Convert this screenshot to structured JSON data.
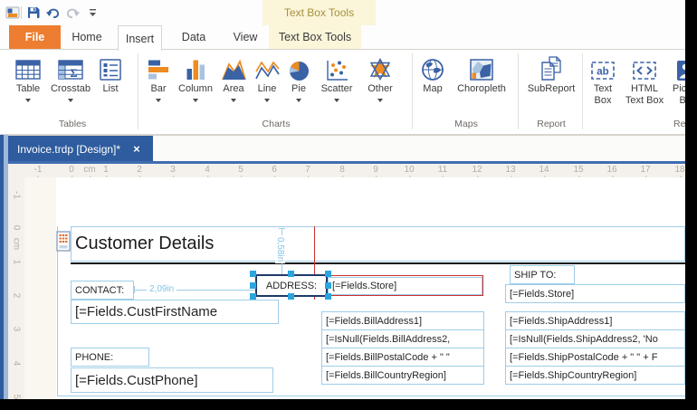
{
  "titlebar": {
    "contextual_title": "Text Box Tools",
    "qat_icons": [
      "app-icon",
      "save-icon",
      "undo-icon",
      "redo-icon",
      "customize-qat-icon"
    ]
  },
  "tabs": {
    "file": "File",
    "home": "Home",
    "insert": "Insert",
    "data": "Data",
    "view": "View",
    "contextual": "Text Box Tools"
  },
  "ribbon": {
    "groups": [
      {
        "label": "Tables",
        "buttons": [
          {
            "label": "Table",
            "dropdown": true
          },
          {
            "label": "Crosstab",
            "dropdown": true
          },
          {
            "label": "List",
            "dropdown": false
          }
        ]
      },
      {
        "label": "Charts",
        "buttons": [
          {
            "label": "Bar",
            "dropdown": true
          },
          {
            "label": "Column",
            "dropdown": true
          },
          {
            "label": "Area",
            "dropdown": true
          },
          {
            "label": "Line",
            "dropdown": true
          },
          {
            "label": "Pie",
            "dropdown": true
          },
          {
            "label": "Scatter",
            "dropdown": true
          },
          {
            "label": "Other",
            "dropdown": true
          }
        ]
      },
      {
        "label": "Maps",
        "buttons": [
          {
            "label": "Map",
            "dropdown": false
          },
          {
            "label": "Choropleth",
            "dropdown": false
          }
        ]
      },
      {
        "label": "Report",
        "buttons": [
          {
            "label": "SubReport",
            "dropdown": false
          }
        ]
      },
      {
        "label": "Report Items",
        "buttons": [
          {
            "label": "Text Box",
            "dropdown": false
          },
          {
            "label": "HTML Text Box",
            "dropdown": false
          },
          {
            "label": "Picture Box",
            "dropdown": false
          }
        ]
      }
    ]
  },
  "document_tab": {
    "title": "Invoice.trdp [Design]*",
    "close_glyph": "×"
  },
  "ruler": {
    "unit": "cm",
    "horizontal": [
      "-1",
      "0",
      "cm",
      "1",
      "2",
      "3",
      "4",
      "5",
      "6",
      "7",
      "8",
      "9",
      "10",
      "11",
      "12",
      "13",
      "14",
      "15",
      "16",
      "17",
      "18"
    ],
    "vertical": [
      "-1",
      "0",
      "cm",
      "1",
      "2",
      "3",
      "4",
      "5"
    ]
  },
  "design": {
    "section_title": "Customer Details",
    "dim_vertical": "0,58in",
    "dim_horizontal": "2,09in",
    "contact_label": "CONTACT:",
    "contact_value": "[=Fields.CustFirstName",
    "phone_label": "PHONE:",
    "phone_value": "[=Fields.CustPhone]",
    "address_label": "ADDRESS:",
    "bill": {
      "store": "[=Fields.Store]",
      "lines": [
        "[=Fields.BillAddress1]",
        "[=IsNull(Fields.BillAddress2,",
        "[=Fields.BillPostalCode + \" \"",
        "[=Fields.BillCountryRegion]"
      ]
    },
    "ship": {
      "label": "SHIP TO:",
      "store": "[=Fields.Store]",
      "lines": [
        "[=Fields.ShipAddress1]",
        "[=IsNull(Fields.ShipAddress2, 'No",
        "[=Fields.ShipPostalCode + \" \" + F",
        "[=Fields.ShipCountryRegion]"
      ]
    }
  },
  "colors": {
    "file_tab_orange": "#ED7D31",
    "contextual_yellow": "#FBF5DA",
    "contextual_text_gold": "#A6913C",
    "doc_tab_blue": "#2E5C9E",
    "adorner_light_blue": "#9ECDE8",
    "selection_handle_blue": "#2AA5DE",
    "selection_border_navy": "#1E3A68",
    "snapline_red": "#CE2F2F",
    "icon_blue": "#3A62A5",
    "icon_orange": "#EE8B21",
    "icon_light_blue": "#A9C2E0"
  }
}
